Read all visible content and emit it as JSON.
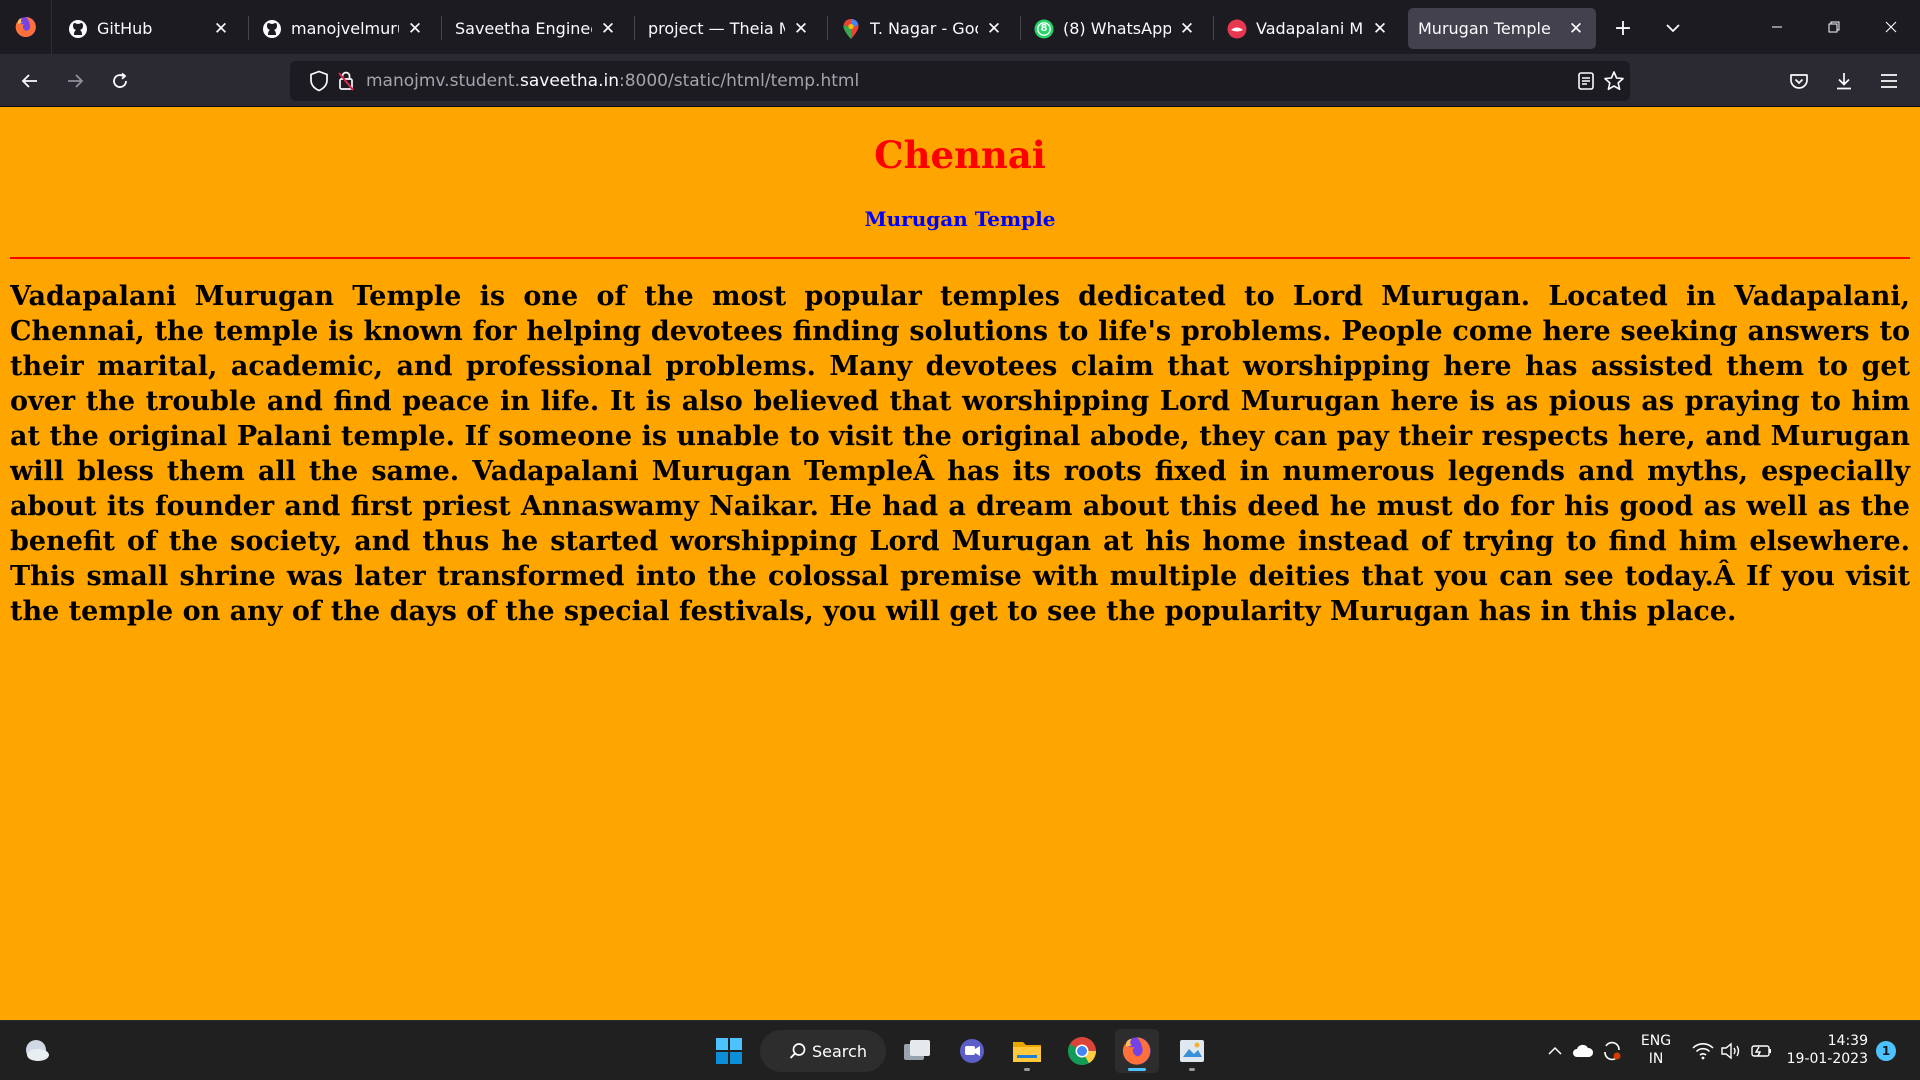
{
  "browser": {
    "tabs": [
      {
        "title": "GitHub",
        "icon": "github-icon",
        "active": false
      },
      {
        "title": "manojvelmurugan",
        "icon": "github-icon",
        "active": false
      },
      {
        "title": "Saveetha Engineering",
        "icon": "none",
        "active": false
      },
      {
        "title": "project — Theia Multi",
        "icon": "none",
        "active": false
      },
      {
        "title": "T. Nagar - Google",
        "icon": "maps-pin-icon",
        "active": false
      },
      {
        "title": "(8) WhatsApp",
        "icon": "whatsapp-icon",
        "active": false
      },
      {
        "title": "Vadapalani Murug",
        "icon": "temple-site-icon",
        "active": false
      },
      {
        "title": "Murugan Temple",
        "icon": "none",
        "active": true
      }
    ],
    "whatsapp_badge": "8",
    "url": {
      "prefix": "manojmv.student.",
      "host": "saveetha.in",
      "suffix": ":8000/static/html/temp.html"
    }
  },
  "page": {
    "background": "#ffa500",
    "heading": "Chennai",
    "heading_color": "#ff0000",
    "subheading": "Murugan Temple",
    "subheading_color": "#0000ff",
    "rule_color": "#ff0000",
    "body": "Vadapalani Murugan Temple is one of the most popular temples dedicated to Lord Murugan. Located in Vadapalani, Chennai, the temple is known for helping devotees finding solutions to life's problems. People come here seeking answers to their marital, academic, and professional problems. Many devotees claim that worshipping here has assisted them to get over the trouble and find peace in life. It is also believed that worshipping Lord Murugan here is as pious as praying to him at the original Palani temple. If someone is unable to visit the original abode, they can pay their respects here, and Murugan will bless them all the same. Vadapalani Murugan TempleÂ has its roots fixed in numerous legends and myths, especially about its founder and first priest Annaswamy Naikar. He had a dream about this deed he must do for his good as well as the benefit of the society, and thus he started worshipping Lord Murugan at his home instead of trying to find him elsewhere. This small shrine was later transformed into the colossal premise with multiple deities that you can see today.Â If you visit the temple on any of the days of the special festivals, you will get to see the popularity Murugan has in this place."
  },
  "taskbar": {
    "search_label": "Search",
    "language": "ENG",
    "region": "IN",
    "time": "14:39",
    "date": "19-01-2023",
    "notification_count": "1"
  }
}
